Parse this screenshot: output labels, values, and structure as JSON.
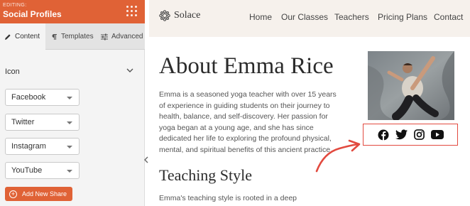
{
  "panel": {
    "editing_label": "EDITING:",
    "title": "Social Profiles",
    "tabs": [
      {
        "label": "Content",
        "icon": "pencil-icon",
        "active": true
      },
      {
        "label": "Templates",
        "icon": "paragraph-icon",
        "active": false
      },
      {
        "label": "Advanced",
        "icon": "sliders-icon",
        "active": false
      }
    ],
    "section_label": "Icon",
    "selects": [
      {
        "value": "Facebook"
      },
      {
        "value": "Twitter"
      },
      {
        "value": "Instagram"
      },
      {
        "value": "YouTube"
      }
    ],
    "add_button_label": "Add New Share",
    "accent_color": "#e06236"
  },
  "preview": {
    "logo_text": "Solace",
    "nav": [
      "Home",
      "Our Classes",
      "Teachers",
      "Pricing Plans",
      "Contact"
    ],
    "heading": "About Emma Rice",
    "bio": "Emma is a seasoned yoga teacher with over 15 years of experience in guiding students on their journey to health, balance, and self-discovery. Her passion for yoga began at a young age, and she has since dedicated her life to exploring the profound physical, mental, and spiritual benefits of this ancient practice.",
    "heading2": "Teaching Style",
    "bio2": "Emma's teaching style is rooted in a deep",
    "social_icons": [
      "facebook-icon",
      "twitter-icon",
      "instagram-icon",
      "youtube-icon"
    ],
    "highlight_color": "#e24a3f"
  }
}
